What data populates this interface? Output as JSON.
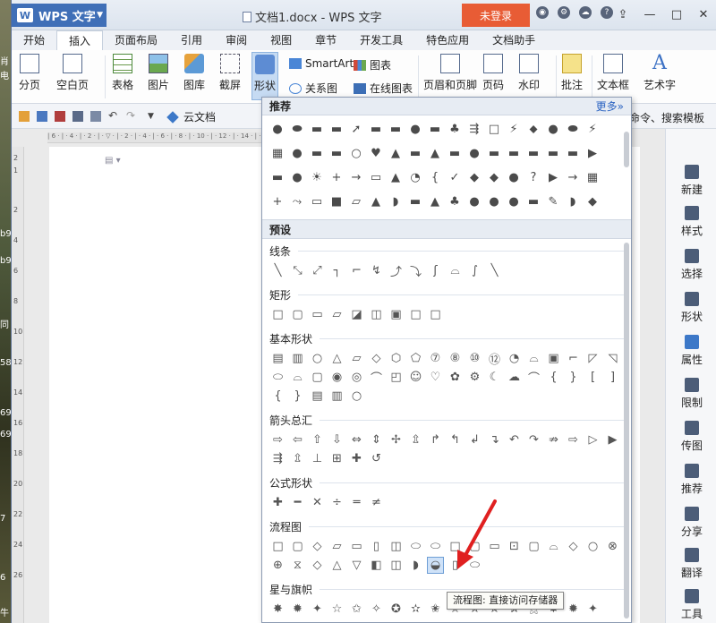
{
  "window": {
    "app_button": "WPS 文字",
    "doc_title": "文档1.docx - WPS 文字",
    "login_button": "未登录"
  },
  "tabs": [
    "开始",
    "插入",
    "页面布局",
    "引用",
    "审阅",
    "视图",
    "章节",
    "开发工具",
    "特色应用",
    "文档助手"
  ],
  "active_tab": "插入",
  "ribbon": {
    "page_break": "分页",
    "blank_page": "空白页",
    "table": "表格",
    "picture": "图片",
    "gallery": "图库",
    "screenshot": "截屏",
    "shapes": "形状",
    "smartart": "SmartArt",
    "chart": "图表",
    "relation": "关系图",
    "online_chart": "在线图表",
    "header_footer": "页眉和页脚",
    "page_number": "页码",
    "watermark": "水印",
    "comment": "批注",
    "textbox": "文本框",
    "wordart": "艺术字"
  },
  "quickbar": {
    "cloud_doc": "云文档",
    "right_text": "找命令、搜索模板"
  },
  "sidepanel": [
    "新建",
    "样式",
    "选择",
    "形状",
    "属性",
    "限制",
    "传图",
    "推荐",
    "分享",
    "翻译",
    "工具"
  ],
  "shapes_panel": {
    "recommended_title": "推荐",
    "more_link": "更多»",
    "preset_title": "预设",
    "categories": [
      {
        "title": "线条"
      },
      {
        "title": "矩形"
      },
      {
        "title": "基本形状"
      },
      {
        "title": "箭头总汇"
      },
      {
        "title": "公式形状"
      },
      {
        "title": "流程图"
      },
      {
        "title": "星与旗帜"
      }
    ]
  },
  "tooltip": "流程图: 直接访问存储器",
  "ruler_v_numbers": [
    "2",
    "1",
    "2",
    "4",
    "6",
    "8",
    "10",
    "12",
    "14",
    "16",
    "18",
    "20",
    "22",
    "24",
    "26"
  ],
  "desktop_fragments": [
    "肖",
    "电",
    "b9",
    "b9",
    "同",
    "58",
    "69",
    "69",
    "7",
    "6",
    "牛"
  ],
  "colors": {
    "wps_blue": "#3f6fb7",
    "login_orange": "#e85c35",
    "pointer_red": "#e02020"
  }
}
